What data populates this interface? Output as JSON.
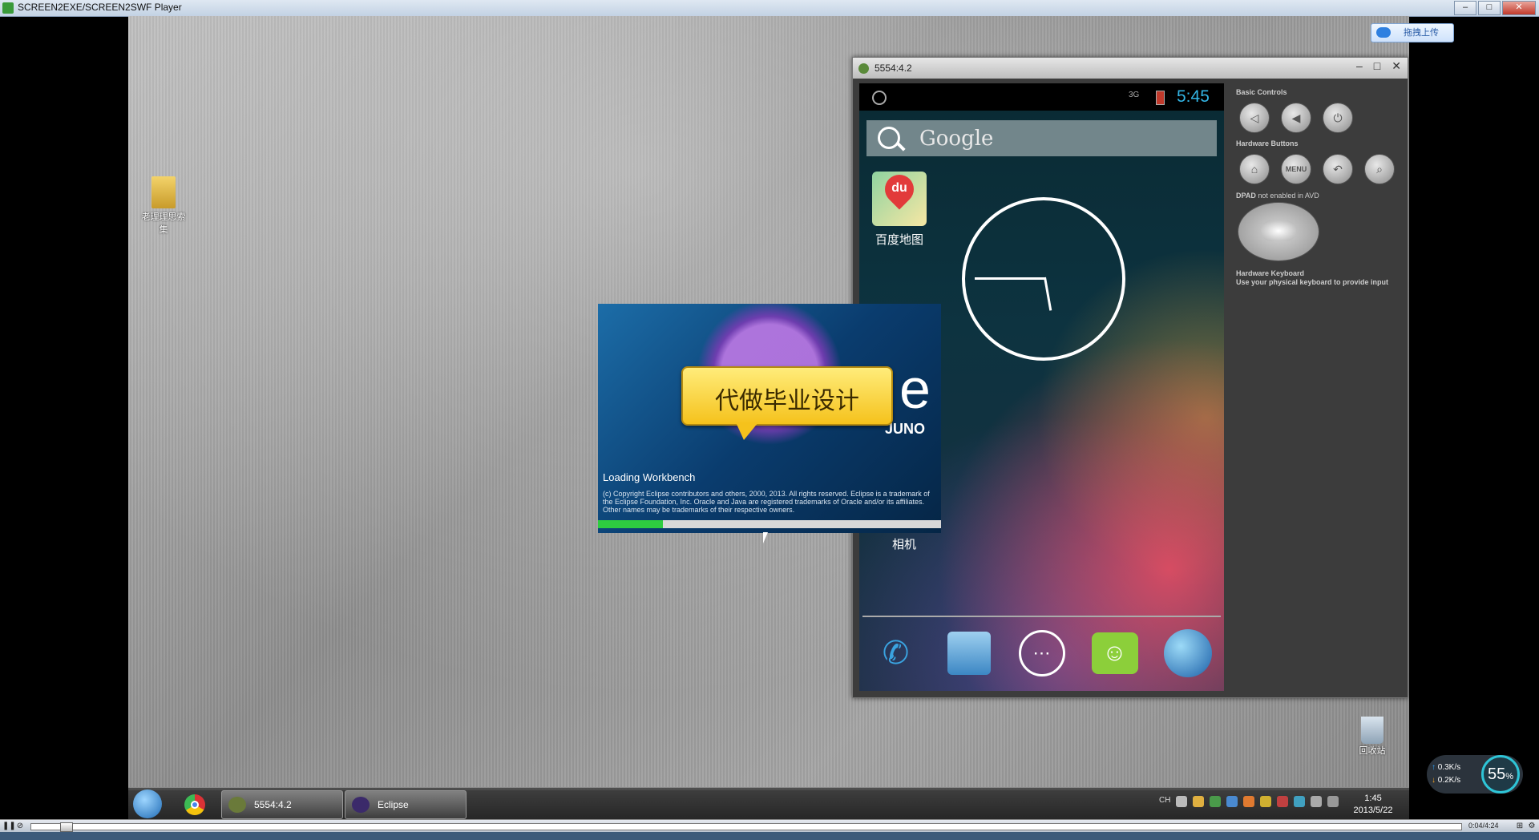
{
  "player": {
    "title": "SCREEN2EXE/SCREEN2SWF Player",
    "min": "–",
    "max": "□",
    "close": "✕",
    "time": "0:04/4:24",
    "progress": 0.02
  },
  "desktop": {
    "folder_label": "老理理思索集",
    "recycle_label": "回收站",
    "upload_button": "拖拽上传"
  },
  "emulator": {
    "title": "5554:4.2",
    "status": {
      "network": "3G",
      "time": "5:45"
    },
    "search": {
      "text": "Google"
    },
    "apps": [
      {
        "label": "百度地图",
        "icon": "baidu-maps-icon",
        "badge": "du"
      },
      {
        "label": "相机",
        "icon": "camera-icon"
      }
    ],
    "dock": [
      "phone-icon",
      "contacts-icon",
      "all-apps-icon",
      "messaging-icon",
      "browser-icon"
    ],
    "panel": {
      "basic_controls": "Basic Controls",
      "hardware_buttons": "Hardware Buttons",
      "menu_label": "MENU",
      "dpad_title": "DPAD",
      "dpad_note": "not enabled in AVD",
      "keyboard_title": "Hardware Keyboard",
      "keyboard_note": "Use your physical keyboard to provide input"
    }
  },
  "splash": {
    "brand_letter": "e",
    "release": "JUNO",
    "loading": "Loading Workbench",
    "copyright": "(c) Copyright Eclipse contributors and others, 2000, 2013.  All rights reserved. Eclipse is a trademark of the Eclipse Foundation, Inc. Oracle and Java are registered trademarks of Oracle and/or its affiliates. Other names may be trademarks of their respective owners.",
    "progress": 0.19
  },
  "bubble": {
    "text": "代做毕业设计"
  },
  "taskbar": {
    "items": [
      {
        "label": "5554:4.2",
        "icon": "emulator-icon"
      },
      {
        "label": "Eclipse",
        "icon": "eclipse-icon"
      }
    ],
    "tray_lang": "CH",
    "clock_time": "1:45",
    "clock_date": "2013/5/22"
  },
  "network_widget": {
    "up": "0.3K/s",
    "down": "0.2K/s",
    "percent": "55",
    "percent_sign": "%"
  },
  "colors": {
    "android_clock_blue": "#33b5e5",
    "progress_green": "#2ecc40",
    "bubble_yellow": "#f5c21c"
  }
}
